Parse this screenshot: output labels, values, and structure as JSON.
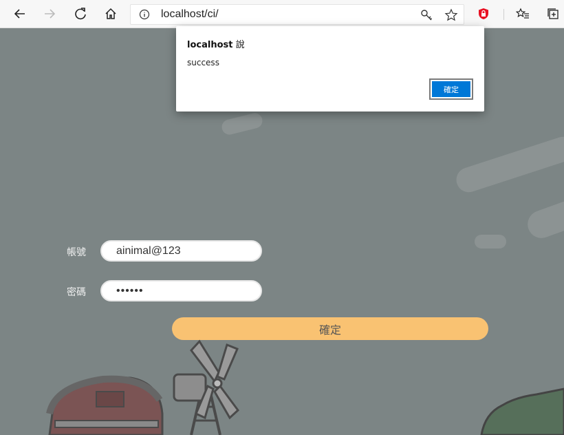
{
  "browser": {
    "url": "localhost/ci/",
    "icons": [
      "back-arrow-icon",
      "forward-arrow-icon",
      "refresh-icon",
      "home-icon",
      "site-info-icon",
      "key-icon",
      "star-icon",
      "shield-icon",
      "favorites-icon",
      "collections-icon"
    ]
  },
  "form": {
    "account_label": "帳號",
    "account_value": "ainimal@123",
    "password_label": "密碼",
    "password_value": "••••••",
    "submit_label": "確定"
  },
  "dialog": {
    "host": "localhost",
    "says": "說",
    "message": "success",
    "ok_label": "確定"
  },
  "colors": {
    "accent": "#0078d7",
    "submit_bg": "#f9c272",
    "page_bg": "#7c8585"
  }
}
